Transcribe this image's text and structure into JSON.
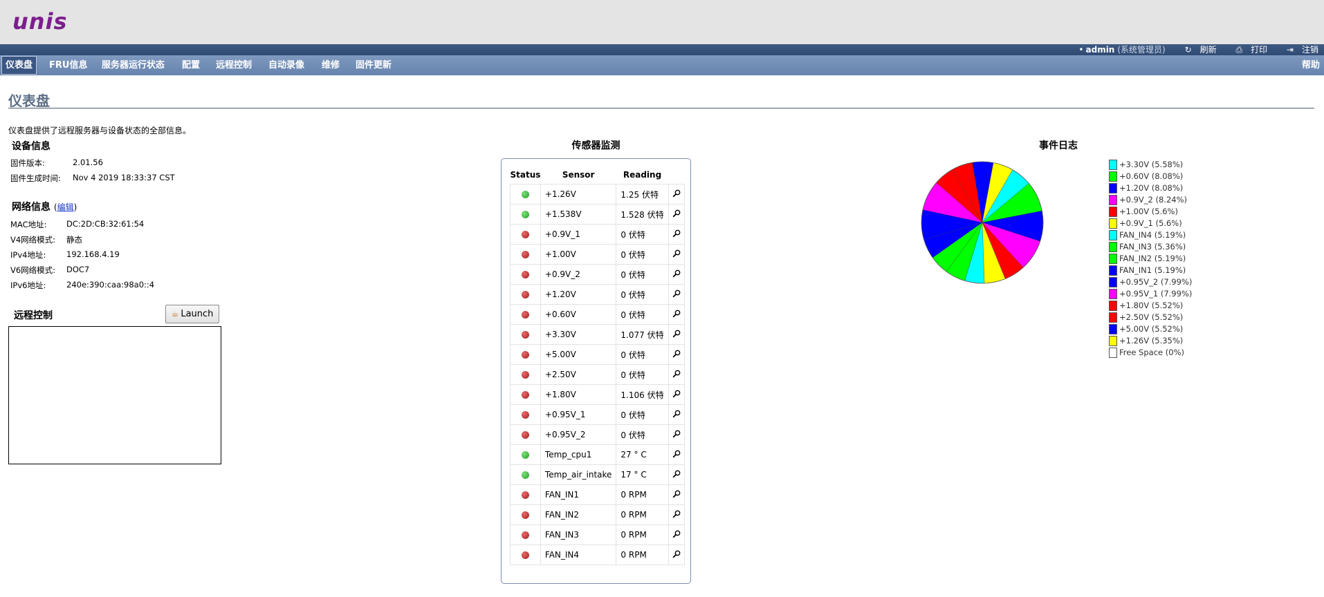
{
  "brand": {
    "logo_text": "unis"
  },
  "userbar": {
    "user": "admin",
    "role": "(系统管理员)",
    "refresh": "刷新",
    "print": "打印",
    "logout": "注销"
  },
  "menu": {
    "items": [
      "仪表盘",
      "FRU信息",
      "服务器运行状态",
      "配置",
      "远程控制",
      "自动录像",
      "维修",
      "固件更新"
    ],
    "help": "帮助"
  },
  "page": {
    "title": "仪表盘",
    "description": "仪表盘提供了远程服务器与设备状态的全部信息。"
  },
  "device_info": {
    "heading": "设备信息",
    "fw_version_label": "固件版本:",
    "fw_version": "2.01.56",
    "fw_build_label": "固件生成时间:",
    "fw_build": "Nov 4 2019 18:33:37 CST"
  },
  "network_info": {
    "heading": "网络信息",
    "edit_link": "编辑",
    "rows": [
      {
        "label": "MAC地址:",
        "value": "DC:2D:CB:32:61:54"
      },
      {
        "label": "V4网络模式:",
        "value": "静态"
      },
      {
        "label": "IPv4地址:",
        "value": "192.168.4.19"
      },
      {
        "label": "V6网络模式:",
        "value": "DOC7"
      },
      {
        "label": "IPv6地址:",
        "value": "240e:390:caa:98a0::4"
      }
    ]
  },
  "remote_control": {
    "heading": "远程控制",
    "launch_label": "Launch"
  },
  "sensors": {
    "title": "传感器监测",
    "headers": {
      "status": "Status",
      "sensor": "Sensor",
      "reading": "Reading"
    },
    "rows": [
      {
        "status": "ok",
        "name": "+1.26V",
        "reading": "1.25 伏特"
      },
      {
        "status": "ok",
        "name": "+1.538V",
        "reading": "1.528 伏特"
      },
      {
        "status": "bad",
        "name": "+0.9V_1",
        "reading": "0 伏特"
      },
      {
        "status": "bad",
        "name": "+1.00V",
        "reading": "0 伏特"
      },
      {
        "status": "bad",
        "name": "+0.9V_2",
        "reading": "0 伏特"
      },
      {
        "status": "bad",
        "name": "+1.20V",
        "reading": "0 伏特"
      },
      {
        "status": "bad",
        "name": "+0.60V",
        "reading": "0 伏特"
      },
      {
        "status": "bad",
        "name": "+3.30V",
        "reading": "1.077 伏特"
      },
      {
        "status": "bad",
        "name": "+5.00V",
        "reading": "0 伏特"
      },
      {
        "status": "bad",
        "name": "+2.50V",
        "reading": "0 伏特"
      },
      {
        "status": "bad",
        "name": "+1.80V",
        "reading": "1.106 伏特"
      },
      {
        "status": "bad",
        "name": "+0.95V_1",
        "reading": "0 伏特"
      },
      {
        "status": "bad",
        "name": "+0.95V_2",
        "reading": "0 伏特"
      },
      {
        "status": "ok",
        "name": "Temp_cpu1",
        "reading": "27 ° C"
      },
      {
        "status": "ok",
        "name": "Temp_air_intake",
        "reading": "17 ° C"
      },
      {
        "status": "bad",
        "name": "FAN_IN1",
        "reading": "0 RPM"
      },
      {
        "status": "bad",
        "name": "FAN_IN2",
        "reading": "0 RPM"
      },
      {
        "status": "bad",
        "name": "FAN_IN3",
        "reading": "0 RPM"
      },
      {
        "status": "bad",
        "name": "FAN_IN4",
        "reading": "0 RPM"
      }
    ]
  },
  "event_log": {
    "title": "事件日志",
    "chart_data": {
      "type": "pie",
      "slices": [
        {
          "label": "+3.30V (5.58%)",
          "value": 5.58,
          "color": "#00ffff"
        },
        {
          "label": "+0.60V (8.08%)",
          "value": 8.08,
          "color": "#00ff00"
        },
        {
          "label": "+1.20V (8.08%)",
          "value": 8.08,
          "color": "#0000ff"
        },
        {
          "label": "+0.9V_2 (8.24%)",
          "value": 8.24,
          "color": "#ff00ff"
        },
        {
          "label": "+1.00V (5.6%)",
          "value": 5.6,
          "color": "#ff0000"
        },
        {
          "label": "+0.9V_1 (5.6%)",
          "value": 5.6,
          "color": "#ffff00"
        },
        {
          "label": "FAN_IN4 (5.19%)",
          "value": 5.19,
          "color": "#00ffff"
        },
        {
          "label": "FAN_IN3 (5.36%)",
          "value": 5.36,
          "color": "#00ff00"
        },
        {
          "label": "FAN_IN2 (5.19%)",
          "value": 5.19,
          "color": "#00ff00"
        },
        {
          "label": "FAN_IN1 (5.19%)",
          "value": 5.19,
          "color": "#0000ff"
        },
        {
          "label": "+0.95V_2 (7.99%)",
          "value": 7.99,
          "color": "#0000ff"
        },
        {
          "label": "+0.95V_1 (7.99%)",
          "value": 7.99,
          "color": "#ff00ff"
        },
        {
          "label": "+1.80V (5.52%)",
          "value": 5.52,
          "color": "#ff0000"
        },
        {
          "label": "+2.50V (5.52%)",
          "value": 5.52,
          "color": "#ff0000"
        },
        {
          "label": "+5.00V (5.52%)",
          "value": 5.52,
          "color": "#0000ff"
        },
        {
          "label": "+1.26V (5.35%)",
          "value": 5.35,
          "color": "#ffff00"
        },
        {
          "label": "Free Space (0%)",
          "value": 0,
          "color": "#ffffff"
        }
      ]
    }
  }
}
